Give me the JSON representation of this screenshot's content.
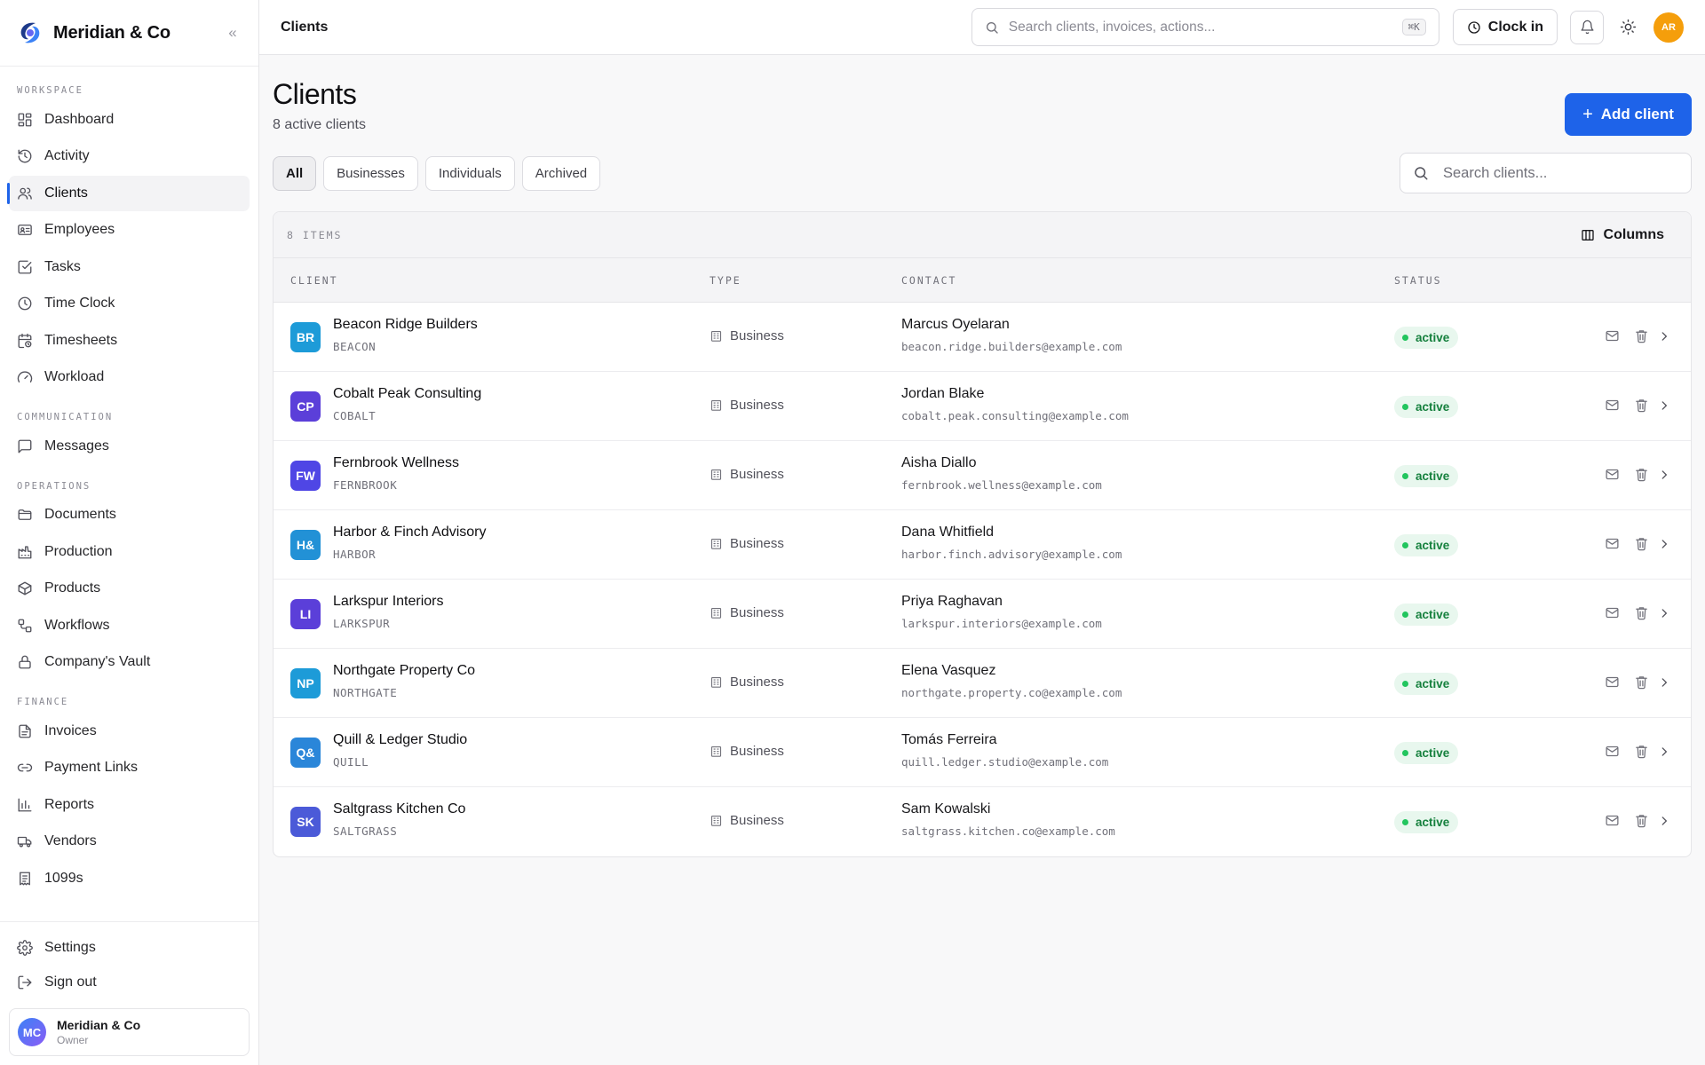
{
  "brand": {
    "name": "Meridian & Co",
    "collapse_icon": "«"
  },
  "sidebar": {
    "sections": [
      {
        "label": "WORKSPACE",
        "items": [
          {
            "label": "Dashboard",
            "icon": "dashboard-icon",
            "active": false
          },
          {
            "label": "Activity",
            "icon": "history-icon",
            "active": false
          },
          {
            "label": "Clients",
            "icon": "users-icon",
            "active": true
          },
          {
            "label": "Employees",
            "icon": "id-card-icon",
            "active": false
          },
          {
            "label": "Tasks",
            "icon": "checkbox-icon",
            "active": false
          },
          {
            "label": "Time Clock",
            "icon": "clock-icon",
            "active": false
          },
          {
            "label": "Timesheets",
            "icon": "calendar-clock-icon",
            "active": false
          },
          {
            "label": "Workload",
            "icon": "gauge-icon",
            "active": false
          }
        ]
      },
      {
        "label": "COMMUNICATION",
        "items": [
          {
            "label": "Messages",
            "icon": "message-icon",
            "active": false
          }
        ]
      },
      {
        "label": "OPERATIONS",
        "items": [
          {
            "label": "Documents",
            "icon": "folder-icon",
            "active": false
          },
          {
            "label": "Production",
            "icon": "factory-icon",
            "active": false
          },
          {
            "label": "Products",
            "icon": "package-icon",
            "active": false
          },
          {
            "label": "Workflows",
            "icon": "workflow-icon",
            "active": false
          },
          {
            "label": "Company's Vault",
            "icon": "lock-icon",
            "active": false
          }
        ]
      },
      {
        "label": "FINANCE",
        "items": [
          {
            "label": "Invoices",
            "icon": "file-text-icon",
            "active": false
          },
          {
            "label": "Payment Links",
            "icon": "link-icon",
            "active": false
          },
          {
            "label": "Reports",
            "icon": "bar-chart-icon",
            "active": false
          },
          {
            "label": "Vendors",
            "icon": "truck-icon",
            "active": false
          },
          {
            "label": "1099s",
            "icon": "receipt-icon",
            "active": false
          }
        ]
      }
    ],
    "settings_label": "Settings",
    "signout_label": "Sign out",
    "profile": {
      "initials": "MC",
      "name": "Meridian & Co",
      "role": "Owner"
    }
  },
  "topbar": {
    "title": "Clients",
    "search_placeholder": "Search clients, invoices, actions...",
    "shortcut": "⌘K",
    "clock_in_label": "Clock in",
    "user_initials": "AR"
  },
  "page": {
    "title": "Clients",
    "subtitle": "8 active clients",
    "add_button_label": "Add client",
    "filters": [
      {
        "label": "All",
        "active": true
      },
      {
        "label": "Businesses",
        "active": false
      },
      {
        "label": "Individuals",
        "active": false
      },
      {
        "label": "Archived",
        "active": false
      }
    ],
    "search_placeholder": "Search clients..."
  },
  "table": {
    "items_label": "8 ITEMS",
    "columns_button_label": "Columns",
    "headers": {
      "client": "CLIENT",
      "type": "TYPE",
      "contact": "CONTACT",
      "status": "STATUS"
    },
    "rows": [
      {
        "initials": "BR",
        "avatar_color": "#1d9bd8",
        "name": "Beacon Ridge Builders",
        "code": "BEACON",
        "type": "Business",
        "contact": "Marcus Oyelaran",
        "email": "beacon.ridge.builders@example.com",
        "status": "active"
      },
      {
        "initials": "CP",
        "avatar_color": "#5b3fd9",
        "name": "Cobalt Peak Consulting",
        "code": "COBALT",
        "type": "Business",
        "contact": "Jordan Blake",
        "email": "cobalt.peak.consulting@example.com",
        "status": "active"
      },
      {
        "initials": "FW",
        "avatar_color": "#4f46e5",
        "name": "Fernbrook Wellness",
        "code": "FERNBROOK",
        "type": "Business",
        "contact": "Aisha Diallo",
        "email": "fernbrook.wellness@example.com",
        "status": "active"
      },
      {
        "initials": "H&",
        "avatar_color": "#2291d6",
        "name": "Harbor & Finch Advisory",
        "code": "HARBOR",
        "type": "Business",
        "contact": "Dana Whitfield",
        "email": "harbor.finch.advisory@example.com",
        "status": "active"
      },
      {
        "initials": "LI",
        "avatar_color": "#5b3fd9",
        "name": "Larkspur Interiors",
        "code": "LARKSPUR",
        "type": "Business",
        "contact": "Priya Raghavan",
        "email": "larkspur.interiors@example.com",
        "status": "active"
      },
      {
        "initials": "NP",
        "avatar_color": "#1d9bd8",
        "name": "Northgate Property Co",
        "code": "NORTHGATE",
        "type": "Business",
        "contact": "Elena Vasquez",
        "email": "northgate.property.co@example.com",
        "status": "active"
      },
      {
        "initials": "Q&",
        "avatar_color": "#2a86d9",
        "name": "Quill & Ledger Studio",
        "code": "QUILL",
        "type": "Business",
        "contact": "Tomás Ferreira",
        "email": "quill.ledger.studio@example.com",
        "status": "active"
      },
      {
        "initials": "SK",
        "avatar_color": "#4b5ad8",
        "name": "Saltgrass Kitchen Co",
        "code": "SALTGRASS",
        "type": "Business",
        "contact": "Sam Kowalski",
        "email": "saltgrass.kitchen.co@example.com",
        "status": "active"
      }
    ]
  },
  "colors": {
    "accent": "#1e63e9",
    "status_green": "#22c55e",
    "status_bg": "#e8f7ee",
    "avatar_top": "#f59e0b"
  }
}
